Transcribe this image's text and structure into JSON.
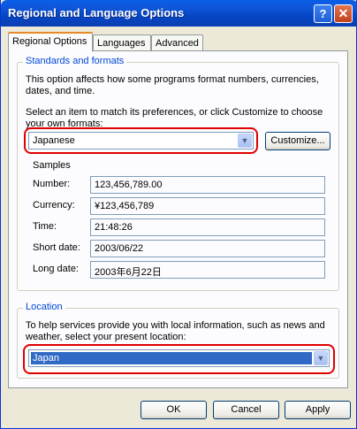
{
  "window": {
    "title": "Regional and Language Options"
  },
  "titlebar_buttons": {
    "help": "?",
    "close": "✕"
  },
  "tabs": [
    {
      "label": "Regional Options",
      "active": true
    },
    {
      "label": "Languages",
      "active": false
    },
    {
      "label": "Advanced",
      "active": false
    }
  ],
  "standards": {
    "group_title": "Standards and formats",
    "description": "This option affects how some programs format numbers, currencies, dates, and time.",
    "select_prompt": "Select an item to match its preferences, or click Customize to choose your own formats:",
    "selected_format": "Japanese",
    "customize_label": "Customize..."
  },
  "samples": {
    "heading": "Samples",
    "rows": [
      {
        "label": "Number:",
        "value": "123,456,789.00"
      },
      {
        "label": "Currency:",
        "value": "¥123,456,789"
      },
      {
        "label": "Time:",
        "value": "21:48:26"
      },
      {
        "label": "Short date:",
        "value": "2003/06/22"
      },
      {
        "label": "Long date:",
        "value": "2003年6月22日"
      }
    ]
  },
  "location": {
    "group_title": "Location",
    "description": "To help services provide you with local information, such as news and weather, select your present location:",
    "selected_location": "Japan"
  },
  "buttons": {
    "ok": "OK",
    "cancel": "Cancel",
    "apply": "Apply"
  },
  "colors": {
    "titlebar": "#0a5fe8",
    "group_title": "#0046d5",
    "annotation_ring": "#e00000",
    "selection": "#316ac5"
  }
}
